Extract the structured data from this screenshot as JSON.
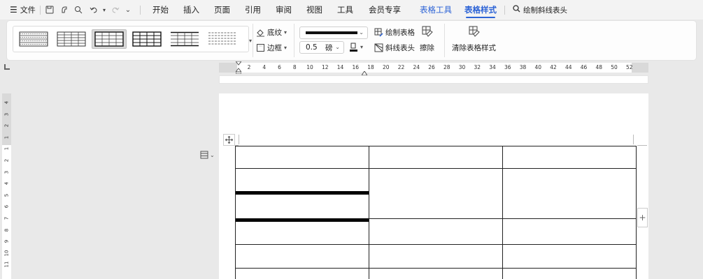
{
  "menubar": {
    "hamburger_label": "文件",
    "tabs": [
      "开始",
      "插入",
      "页面",
      "引用",
      "审阅",
      "视图",
      "工具",
      "会员专享",
      "表格工具",
      "表格样式"
    ],
    "active_tab": "表格样式",
    "search_label": "绘制斜线表头"
  },
  "ribbon": {
    "shading_label": "底纹",
    "border_label": "边框",
    "line_width_value": "0.5",
    "line_width_unit": "磅",
    "draw_table_label": "绘制表格",
    "diagonal_header_label": "斜线表头",
    "erase_label": "擦除",
    "clear_style_label": "清除表格样式"
  },
  "ruler": {
    "h_ticks": [
      "2",
      "4",
      "6",
      "8",
      "10",
      "12",
      "14",
      "16",
      "18",
      "20",
      "22",
      "24",
      "26",
      "28",
      "30",
      "32",
      "34",
      "36",
      "38",
      "40",
      "42",
      "44",
      "46",
      "48",
      "50",
      "52"
    ],
    "v_ticks": [
      "4",
      "3",
      "2",
      "1",
      "1",
      "2",
      "3",
      "4",
      "5",
      "6",
      "7",
      "8",
      "9",
      "10",
      "11"
    ]
  },
  "document": {
    "table_rows": 6,
    "table_cols": 3
  }
}
